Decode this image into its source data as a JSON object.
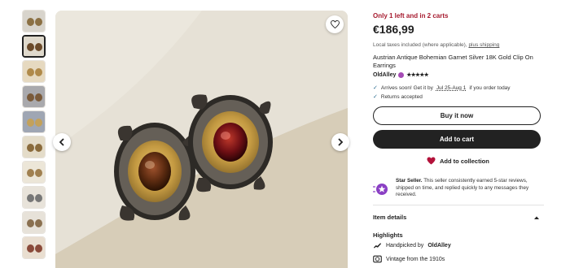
{
  "product": {
    "stock_notice": "Only 1 left and in 2 carts",
    "price": "€186,99",
    "tax_note": "Local taxes included (where applicable),",
    "tax_link": "plus shipping",
    "title": "Austrian Antique Bohemian Garnet Silver 18K Gold Clip On Earrings",
    "shop_name": "OldAlley",
    "rating_stars": "★★★★★"
  },
  "shipping": {
    "arrival_prefix": "Arrives soon! Get it by",
    "arrival_dates": "Jul 25-Aug 1",
    "arrival_suffix": "if you order today",
    "returns": "Returns accepted"
  },
  "actions": {
    "buy_now": "Buy it now",
    "add_to_cart": "Add to cart",
    "add_to_collection": "Add to collection"
  },
  "star_seller": {
    "label": "Star Seller.",
    "text": "This seller consistently earned 5-star reviews, shipped on time, and replied quickly to any messages they received."
  },
  "details": {
    "section_title": "Item details",
    "highlights_title": "Highlights",
    "handpicked_prefix": "Handpicked by",
    "handpicked_shop": "OldAlley",
    "vintage": "Vintage from the 1910s"
  },
  "gallery": {
    "thumbnail_count": 10,
    "active_index": 1
  },
  "colors": {
    "accent_red": "#a61a2e",
    "primary_dark": "#222222",
    "heart_red": "#b3123a",
    "star_seller_purple": "#8a3fc4"
  }
}
